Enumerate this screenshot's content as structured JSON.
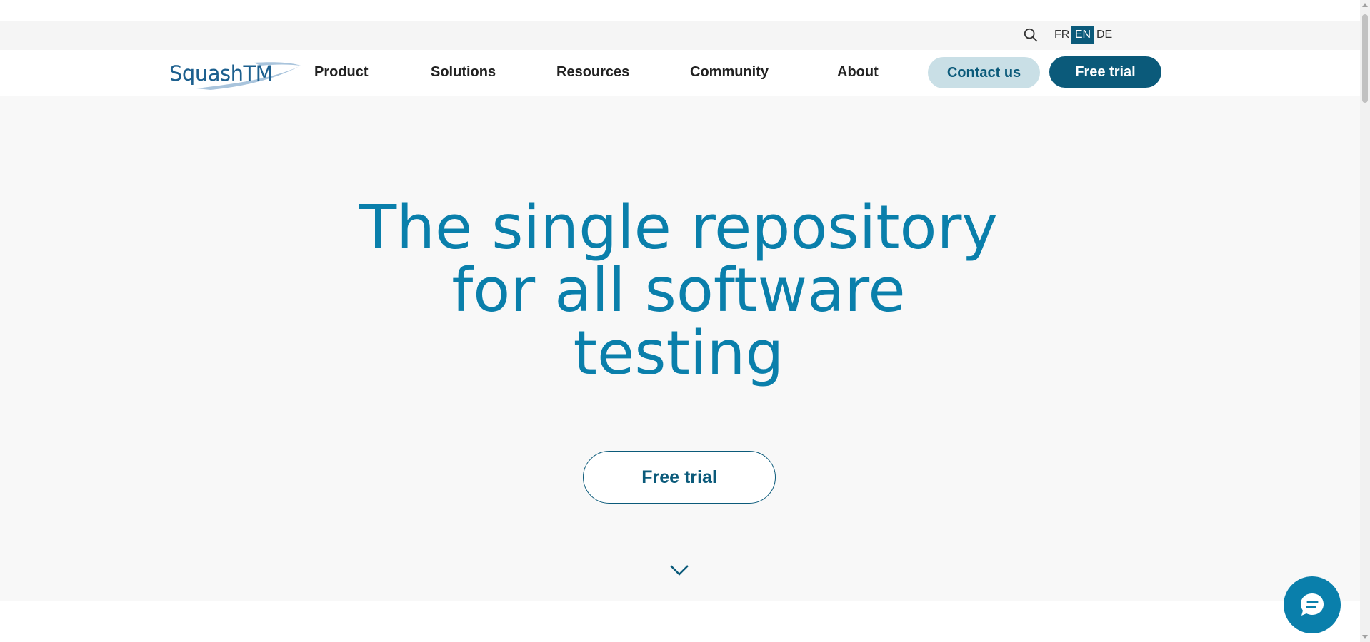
{
  "utility_bar": {
    "search_icon": "search-icon",
    "languages": [
      "FR",
      "EN",
      "DE"
    ],
    "active_language": "EN"
  },
  "header": {
    "logo_text": "SquashTM",
    "nav": {
      "product": "Product",
      "solutions": "Solutions",
      "resources": "Resources",
      "community": "Community",
      "about": "About"
    },
    "contact_label": "Contact us",
    "free_trial_label": "Free trial"
  },
  "hero": {
    "title_lines": [
      "The single repository",
      "for all software",
      "testing"
    ],
    "cta_label": "Free trial",
    "scroll_icon": "chevron-down-icon"
  },
  "chat": {
    "icon": "chat-icon"
  },
  "colors": {
    "brand_dark": "#0b5a7a",
    "brand_light": "#0a7fab",
    "contact_bg": "#c9dfe6",
    "hero_bg": "#f8f8f8",
    "utility_bg": "#f5f5f5"
  }
}
